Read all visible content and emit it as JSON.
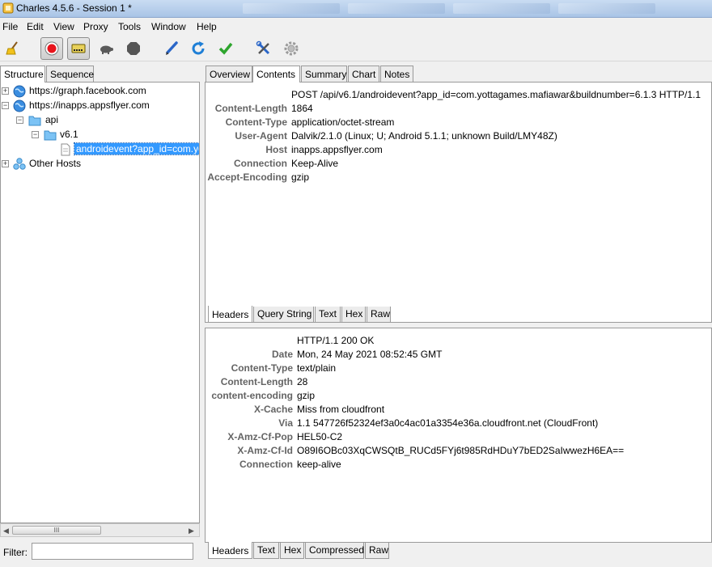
{
  "window": {
    "title": "Charles 4.5.6 - Session 1 *"
  },
  "menu": [
    "File",
    "Edit",
    "View",
    "Proxy",
    "Tools",
    "Window",
    "Help"
  ],
  "toolbar": {
    "icons": [
      "broom-icon",
      "record-icon",
      "throttle-icon",
      "turtle-icon",
      "stop-icon",
      "pen-icon",
      "refresh-icon",
      "checkmark-icon",
      "tools-icon",
      "settings-icon"
    ],
    "record_color": "#e8141c",
    "check_color": "#2ea52e",
    "refresh_color": "#1f7fd6"
  },
  "left": {
    "tabs": [
      "Structure",
      "Sequence"
    ],
    "active_tab": "Structure",
    "tree": [
      {
        "label": "https://graph.facebook.com",
        "expander": "+",
        "icon": "globe-icon"
      },
      {
        "label": "https://inapps.appsflyer.com",
        "expander": "−",
        "icon": "globe-icon"
      },
      {
        "label": "api",
        "expander": "−",
        "icon": "folder-icon"
      },
      {
        "label": "v6.1",
        "expander": "−",
        "icon": "folder-icon"
      },
      {
        "label": "androidevent?app_id=com.yo",
        "expander": "",
        "icon": "document-icon"
      },
      {
        "label": "Other Hosts",
        "expander": "+",
        "icon": "cluster-icon"
      }
    ],
    "scroll_thumb": "III",
    "filter_label": "Filter:",
    "filter_value": ""
  },
  "right": {
    "tabs": [
      "Overview",
      "Contents",
      "Summary",
      "Chart",
      "Notes"
    ],
    "active_tab": "Contents",
    "request": {
      "first_line": "POST /api/v6.1/androidevent?app_id=com.yottagames.mafiawar&buildnumber=6.1.3 HTTP/1.1",
      "headers": [
        {
          "key": "Content-Length",
          "value": "1864"
        },
        {
          "key": "Content-Type",
          "value": "application/octet-stream"
        },
        {
          "key": "User-Agent",
          "value": "Dalvik/2.1.0 (Linux; U; Android 5.1.1; unknown Build/LMY48Z)"
        },
        {
          "key": "Host",
          "value": "inapps.appsflyer.com"
        },
        {
          "key": "Connection",
          "value": "Keep-Alive"
        },
        {
          "key": "Accept-Encoding",
          "value": "gzip"
        }
      ],
      "tabs": [
        "Headers",
        "Query String",
        "Text",
        "Hex",
        "Raw"
      ],
      "active_tab": "Headers"
    },
    "response": {
      "first_line": "HTTP/1.1 200 OK",
      "headers": [
        {
          "key": "Date",
          "value": "Mon, 24 May 2021 08:52:45 GMT"
        },
        {
          "key": "Content-Type",
          "value": "text/plain"
        },
        {
          "key": "Content-Length",
          "value": "28"
        },
        {
          "key": "content-encoding",
          "value": "gzip"
        },
        {
          "key": "X-Cache",
          "value": "Miss from cloudfront"
        },
        {
          "key": "Via",
          "value": "1.1 547726f52324ef3a0c4ac01a3354e36a.cloudfront.net (CloudFront)"
        },
        {
          "key": "X-Amz-Cf-Pop",
          "value": "HEL50-C2"
        },
        {
          "key": "X-Amz-Cf-Id",
          "value": "O89I6OBc03XqCWSQtB_RUCd5FYj6t985RdHDuY7bED2SaIwwezH6EA=="
        },
        {
          "key": "Connection",
          "value": "keep-alive"
        }
      ],
      "tabs": [
        "Headers",
        "Text",
        "Hex",
        "Compressed",
        "Raw"
      ],
      "active_tab": "Headers"
    }
  }
}
